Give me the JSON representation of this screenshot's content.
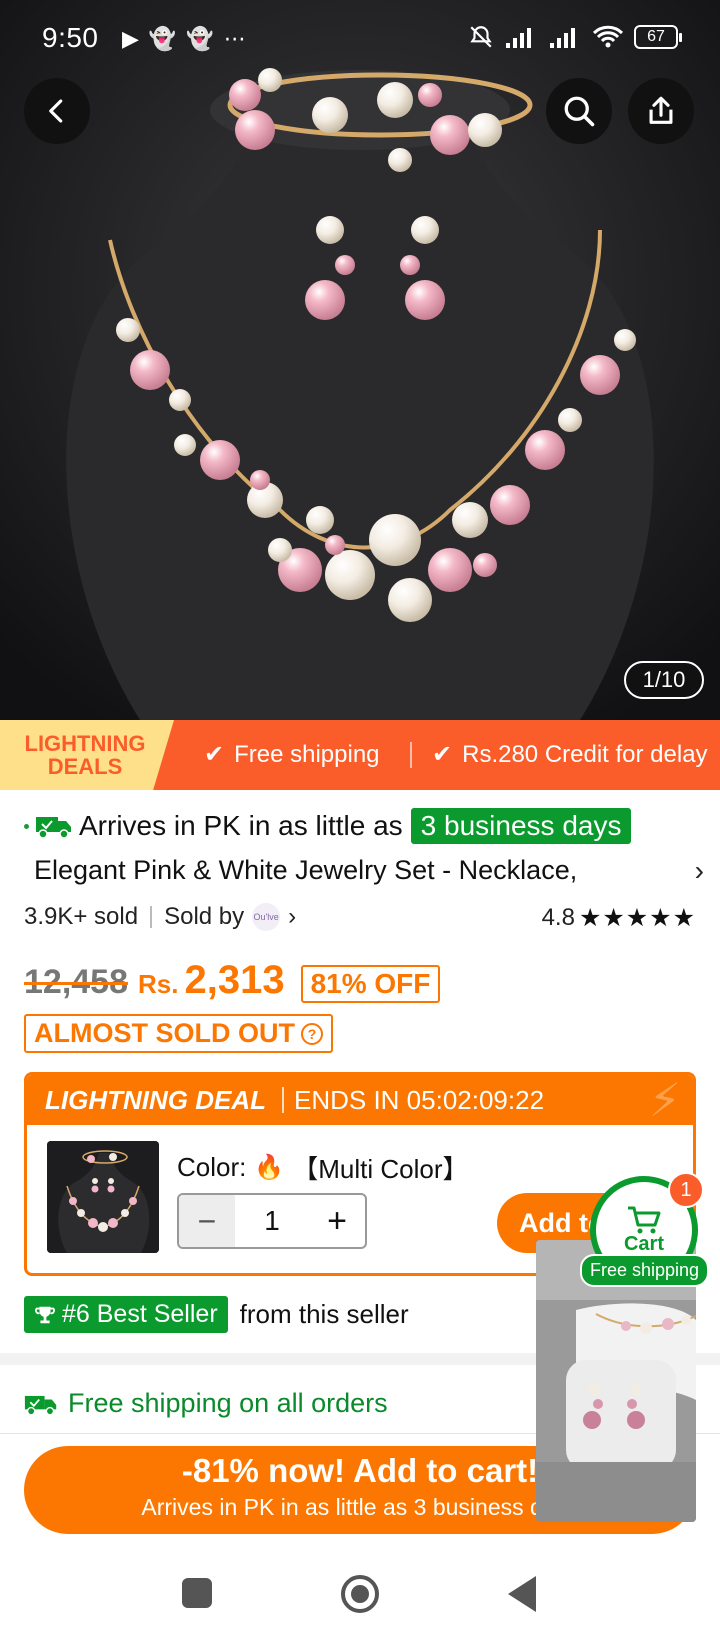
{
  "status_bar": {
    "time": "9:50",
    "battery": "67"
  },
  "gallery": {
    "counter": "1/10"
  },
  "promo": {
    "badge_line1": "LIGHTNING",
    "badge_line2": "DEALS",
    "item1": "Free shipping",
    "item2": "Rs.280 Credit for delay"
  },
  "product": {
    "arrives_text": "Arrives in PK in as little as",
    "arrives_days": "3 business days",
    "title": "Elegant Pink & White Jewelry Set - Necklace,",
    "sold": "3.9K+ sold",
    "sold_by": "Sold by",
    "seller_logo": "Ou'lve",
    "rating": "4.8",
    "stars": "★★★★★",
    "old_price": "12,458",
    "currency": "Rs.",
    "price": "2,313",
    "discount": "81% OFF",
    "stock_status": "ALMOST SOLD OUT"
  },
  "deal": {
    "label": "LIGHTNING DEAL",
    "ends_in": "ENDS IN 05:02:09:22",
    "color_label": "Color:",
    "color_value": "【Multi Color】",
    "quantity": "1",
    "add_button": "Add to"
  },
  "best_seller": {
    "badge": "#6 Best Seller",
    "suffix": "from this seller"
  },
  "shipping": {
    "text": "Free shipping on all orders"
  },
  "cta": {
    "main": "-81% now! Add to cart!",
    "sub": "Arrives in PK in as little as 3 business days"
  },
  "cart": {
    "label": "Cart",
    "count": "1",
    "shipping_badge": "Free shipping"
  },
  "colors": {
    "accent": "#fb7701",
    "promo": "#fb5d2a",
    "green": "#0b9a2e"
  },
  "icons": [
    "back-arrow-icon",
    "search-icon",
    "share-icon",
    "truck-icon",
    "trophy-icon",
    "cart-icon",
    "flame-icon",
    "question-icon"
  ]
}
